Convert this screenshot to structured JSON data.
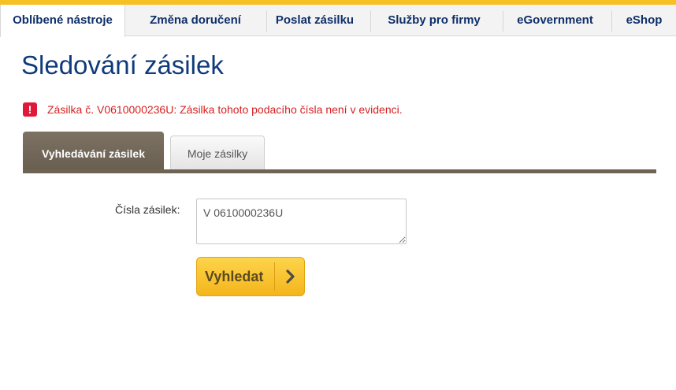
{
  "nav": {
    "tabs": [
      {
        "label": "Oblíbené nástroje",
        "active": true
      },
      {
        "label": "Změna doručení",
        "active": false
      },
      {
        "label": "Poslat zásilku",
        "active": false
      },
      {
        "label": "Služby pro firmy",
        "active": false
      },
      {
        "label": "eGovernment",
        "active": false
      },
      {
        "label": "eShop",
        "active": false
      }
    ]
  },
  "page": {
    "title": "Sledování zásilek"
  },
  "alert": {
    "icon": "exclamation-icon",
    "symbol": "!",
    "text": "Zásilka č. V0610000236U: Zásilka tohoto podacího čísla není v evidenci.",
    "color": "#d62020"
  },
  "tabs": {
    "search_label": "Vyhledávání zásilek",
    "my_shipments_label": "Moje zásilky"
  },
  "form": {
    "label": "Čísla zásilek:",
    "value": "V 0610000236U",
    "submit_label": "Vyhledat",
    "submit_icon": "chevron-right-icon"
  },
  "colors": {
    "accent_yellow": "#f5c125",
    "brand_blue": "#103a7c",
    "tab_brown": "#6e6355"
  }
}
